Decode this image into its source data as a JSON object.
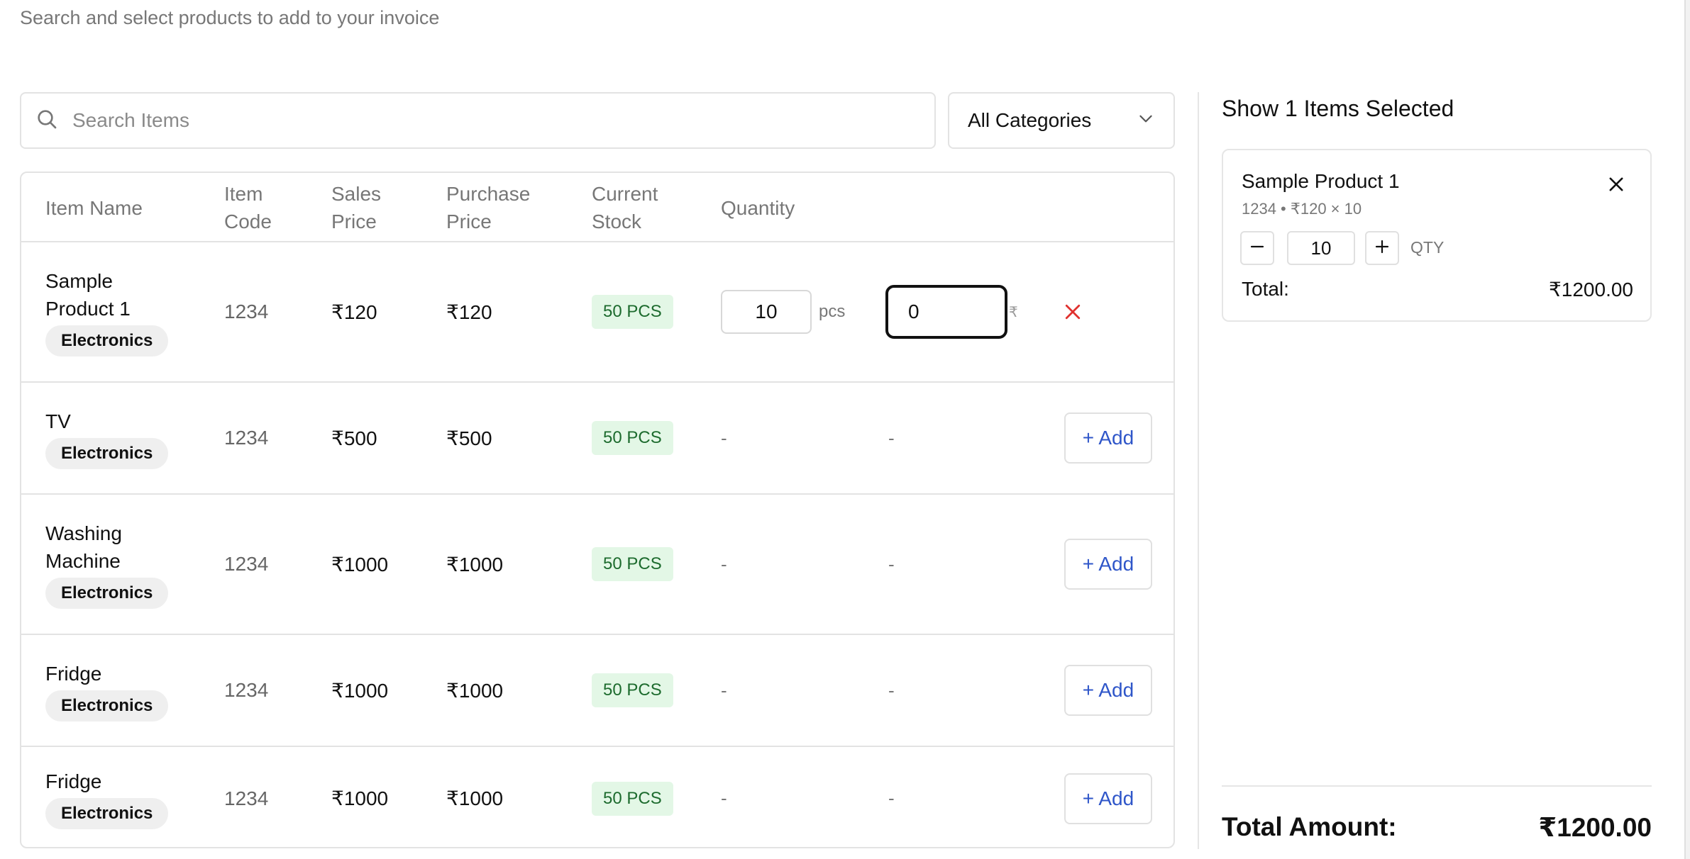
{
  "header": {
    "subtitle": "Search and select products to add to your invoice"
  },
  "search": {
    "placeholder": "Search Items",
    "value": ""
  },
  "category_filter": {
    "selected": "All Categories"
  },
  "table": {
    "headers": {
      "item_name": "Item Name",
      "item_code": "Item Code",
      "sales_price": "Sales Price",
      "purchase_price": "Purchase Price",
      "current_stock": "Current Stock",
      "quantity": "Quantity"
    },
    "rows": [
      {
        "name": "Sample Product 1",
        "category": "Electronics",
        "code": "1234",
        "sales_price": "₹120",
        "purchase_price": "₹120",
        "stock": "50 PCS",
        "quantity": "10",
        "unit": "pcs",
        "price_value": "0",
        "price_symbol": "₹",
        "action": "remove"
      },
      {
        "name": "TV",
        "category": "Electronics",
        "code": "1234",
        "sales_price": "₹500",
        "purchase_price": "₹500",
        "stock": "50 PCS",
        "quantity": "-",
        "price_value": "-",
        "action_label": "+ Add"
      },
      {
        "name": "Washing Machine",
        "category": "Electronics",
        "code": "1234",
        "sales_price": "₹1000",
        "purchase_price": "₹1000",
        "stock": "50 PCS",
        "quantity": "-",
        "price_value": "-",
        "action_label": "+ Add"
      },
      {
        "name": "Fridge",
        "category": "Electronics",
        "code": "1234",
        "sales_price": "₹1000",
        "purchase_price": "₹1000",
        "stock": "50 PCS",
        "quantity": "-",
        "price_value": "-",
        "action_label": "+ Add"
      },
      {
        "name": "Fridge",
        "category": "Electronics",
        "code": "1234",
        "sales_price": "₹1000",
        "purchase_price": "₹1000",
        "stock": "50 PCS",
        "quantity": "-",
        "price_value": "-",
        "action_label": "+ Add"
      }
    ]
  },
  "selection_panel": {
    "title": "Show 1 Items Selected",
    "items": [
      {
        "name": "Sample Product 1",
        "meta": "1234 • ₹120 × 10",
        "quantity": "10",
        "qty_label": "QTY",
        "total_label": "Total:",
        "total_value": "₹1200.00"
      }
    ],
    "total_amount_label": "Total Amount:",
    "total_amount_value": "₹1200.00"
  },
  "icons": {
    "search": "search-icon",
    "dropdown": "chevron-down-icon",
    "remove": "close-icon",
    "minus": "minus-icon",
    "plus": "plus-icon"
  },
  "colors": {
    "accent": "#2f56c9",
    "danger": "#e0312e",
    "stock_badge_bg": "#e3f7e6",
    "stock_badge_text": "#1d6b2e"
  }
}
